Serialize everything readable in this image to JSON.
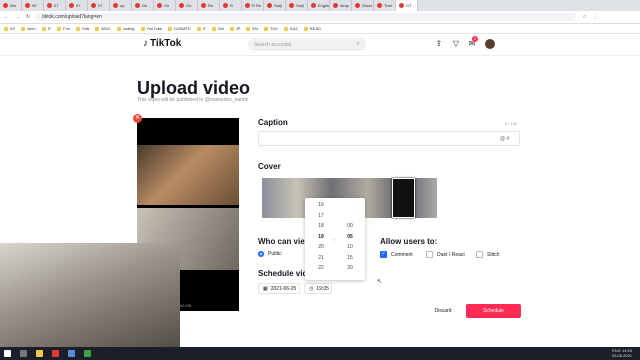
{
  "browser": {
    "tabs": [
      "We",
      "0E",
      "07",
      "07",
      "07",
      "up",
      "Ge",
      "Ge",
      "Go",
      "Re",
      "R",
      "R Re",
      "Sarji",
      "Sarji",
      "Englis",
      "strap",
      "Glose",
      "Tree",
      "GT"
    ],
    "active_tab_index": 18,
    "url": "tiktok.com/upload?lang=en",
    "bookmarks": [
      "KZ",
      "Aero",
      "IT",
      "Fun",
      "Soft",
      "WDC",
      "coding",
      "YouTube",
      "DONATE",
      "IT",
      "Dili",
      "JP",
      "EN",
      "TUK",
      "KAZ",
      "READ"
    ]
  },
  "header": {
    "logo": "TikTok",
    "search_placeholder": "Search accounts",
    "inbox_badge": "2"
  },
  "page": {
    "title": "Upload video",
    "subtitle": "This video will be published to @mamedov_namik",
    "file_size": "63 MB"
  },
  "caption": {
    "label": "Caption",
    "count": "0 / 150"
  },
  "cover": {
    "label": "Cover"
  },
  "who_can_view": {
    "label": "Who can vie",
    "option": "Public"
  },
  "allow_users": {
    "label": "Allow users to:",
    "options": [
      {
        "label": "Comment",
        "checked": true
      },
      {
        "label": "Duet / React",
        "checked": false
      },
      {
        "label": "Stitch",
        "checked": false
      }
    ]
  },
  "schedule": {
    "label": "Schedule vid",
    "date": "2021-06-25",
    "time": "19:05"
  },
  "time_picker": {
    "hours": [
      "16",
      "17",
      "18",
      "19",
      "20",
      "21",
      "22"
    ],
    "minutes": [
      "00",
      "05",
      "10",
      "15",
      "20"
    ],
    "selected_hour": "19",
    "selected_minute": "05"
  },
  "buttons": {
    "discard": "Discard",
    "schedule": "Schedule"
  },
  "taskbar": {
    "lang": "ENG",
    "time": "14:53",
    "date": "25.06.2021"
  },
  "colors": {
    "accent": "#fe2c55",
    "checkbox": "#1d66ff"
  }
}
